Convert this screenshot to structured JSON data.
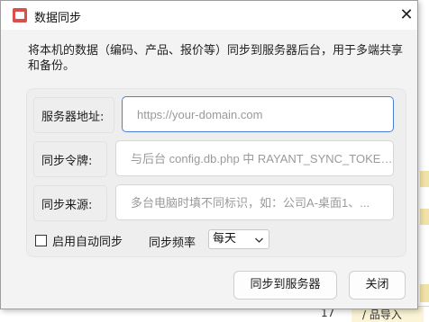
{
  "window": {
    "title": "数据同步",
    "close_glyph": "✕"
  },
  "description": "将本机的数据（编码、产品、报价等）同步到服务器后台，用于多端共享和备份。",
  "form": {
    "server": {
      "label": "服务器地址:",
      "placeholder": "https://your-domain.com"
    },
    "token": {
      "label": "同步令牌:",
      "placeholder": "与后台 config.db.php 中 RAYANT_SYNC_TOKEN 一致"
    },
    "source": {
      "label": "同步来源:",
      "placeholder": "多台电脑时填不同标识，如：公司A-桌面1、..."
    },
    "auto_sync_label": "启用自动同步",
    "frequency_label": "同步频率",
    "frequency_value": "每天"
  },
  "buttons": {
    "sync": "同步到服务器",
    "close": "关闭"
  },
  "background": {
    "fragment": "17",
    "fragment2": "/  品导入"
  }
}
